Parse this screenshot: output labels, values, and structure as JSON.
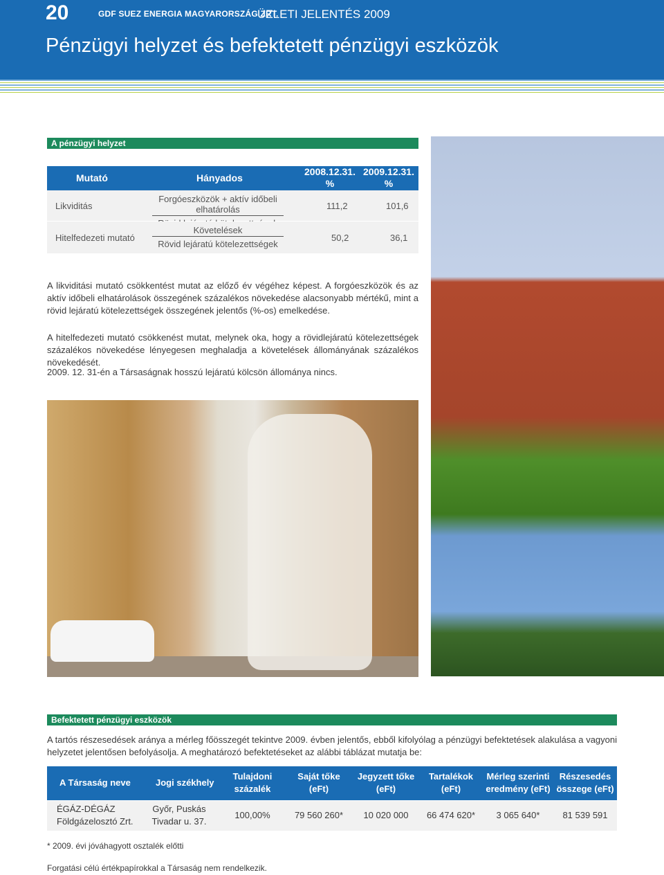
{
  "header": {
    "page_number": "20",
    "company": "GDF SUEZ ENERGIA MAGYARORSZÁG ZRT.",
    "report": "ÜZLETI JELENTÉS 2009",
    "title": "Pénzügyi helyzet és befektetett pénzügyi eszközök"
  },
  "section1": {
    "title": "A pénzügyi helyzet",
    "table": {
      "headers": {
        "mutato": "Mutató",
        "hanyados": "Hányados",
        "y2008": "2008.12.31.",
        "y2008_unit": "%",
        "y2009": "2009.12.31.",
        "y2009_unit": "%"
      },
      "rows": [
        {
          "name": "Likviditás",
          "numerator": "Forgóeszközök + aktív időbeli elhatárolás",
          "denominator": "Rövid lejáratú kötelezettségek",
          "v2008": "111,2",
          "v2009": "101,6"
        },
        {
          "name": "Hitelfedezeti mutató",
          "numerator": "Követelések",
          "denominator": "Rövid lejáratú kötelezettségek",
          "v2008": "50,2",
          "v2009": "36,1"
        }
      ]
    },
    "paragraphs": [
      "A likviditási mutató csökkentést mutat az előző év végéhez képest. A forgóeszközök és az aktív időbeli elhatárolások összegének százalékos növekedése alacsonyabb mértékű, mint a rövid lejáratú kötelezettségek összegének jelentős (%-os) emelkedése.",
      "A hitelfedezeti mutató csökkenést mutat, melynek oka, hogy a rövidlejáratú kötelezettségek százalékos növekedése lényegesen meghaladja a követelések állományának százalékos növekedését.",
      "2009. 12. 31-én a Társaságnak hosszú lejáratú kölcsön állománya nincs."
    ]
  },
  "section2": {
    "title": "Befektetett pénzügyi eszközök",
    "intro": "A tartós részesedések aránya a mérleg főösszegét tekintve 2009. évben jelentős, ebből kifolyólag a pénzügyi befektetések alakulása a vagyoni helyzetet jelentősen befolyásolja. A meghatározó befektetéseket az alábbi táblázat mutatja be:",
    "table": {
      "headers": {
        "name": "A Társaság neve",
        "seat": "Jogi székhely",
        "own_1": "Tulajdoni",
        "own_2": "százalék",
        "equity_1": "Saját tőke",
        "equity_2": "(eFt)",
        "subscribed_1": "Jegyzett tőke",
        "subscribed_2": "(eFt)",
        "reserves_1": "Tartalékok",
        "reserves_2": "(eFt)",
        "result_1": "Mérleg szerinti",
        "result_2": "eredmény (eFt)",
        "share_1": "Részesedés",
        "share_2": "összege (eFt)"
      },
      "row": {
        "name_1": "ÉGÁZ-DÉGÁZ",
        "name_2": "Földgázelosztó Zrt.",
        "seat_1": "Győr, Puskás",
        "seat_2": "Tivadar u. 37.",
        "own": "100,00%",
        "equity": "79 560 260*",
        "subscribed": "10 020 000",
        "reserves": "66 474 620*",
        "result": "3 065 640*",
        "share": "81 539 591"
      }
    },
    "footnote": "* 2009. évi jóváhagyott osztalék előtti",
    "note": "Forgatási célú értékpapírokkal a Társaság nem rendelkezik."
  }
}
